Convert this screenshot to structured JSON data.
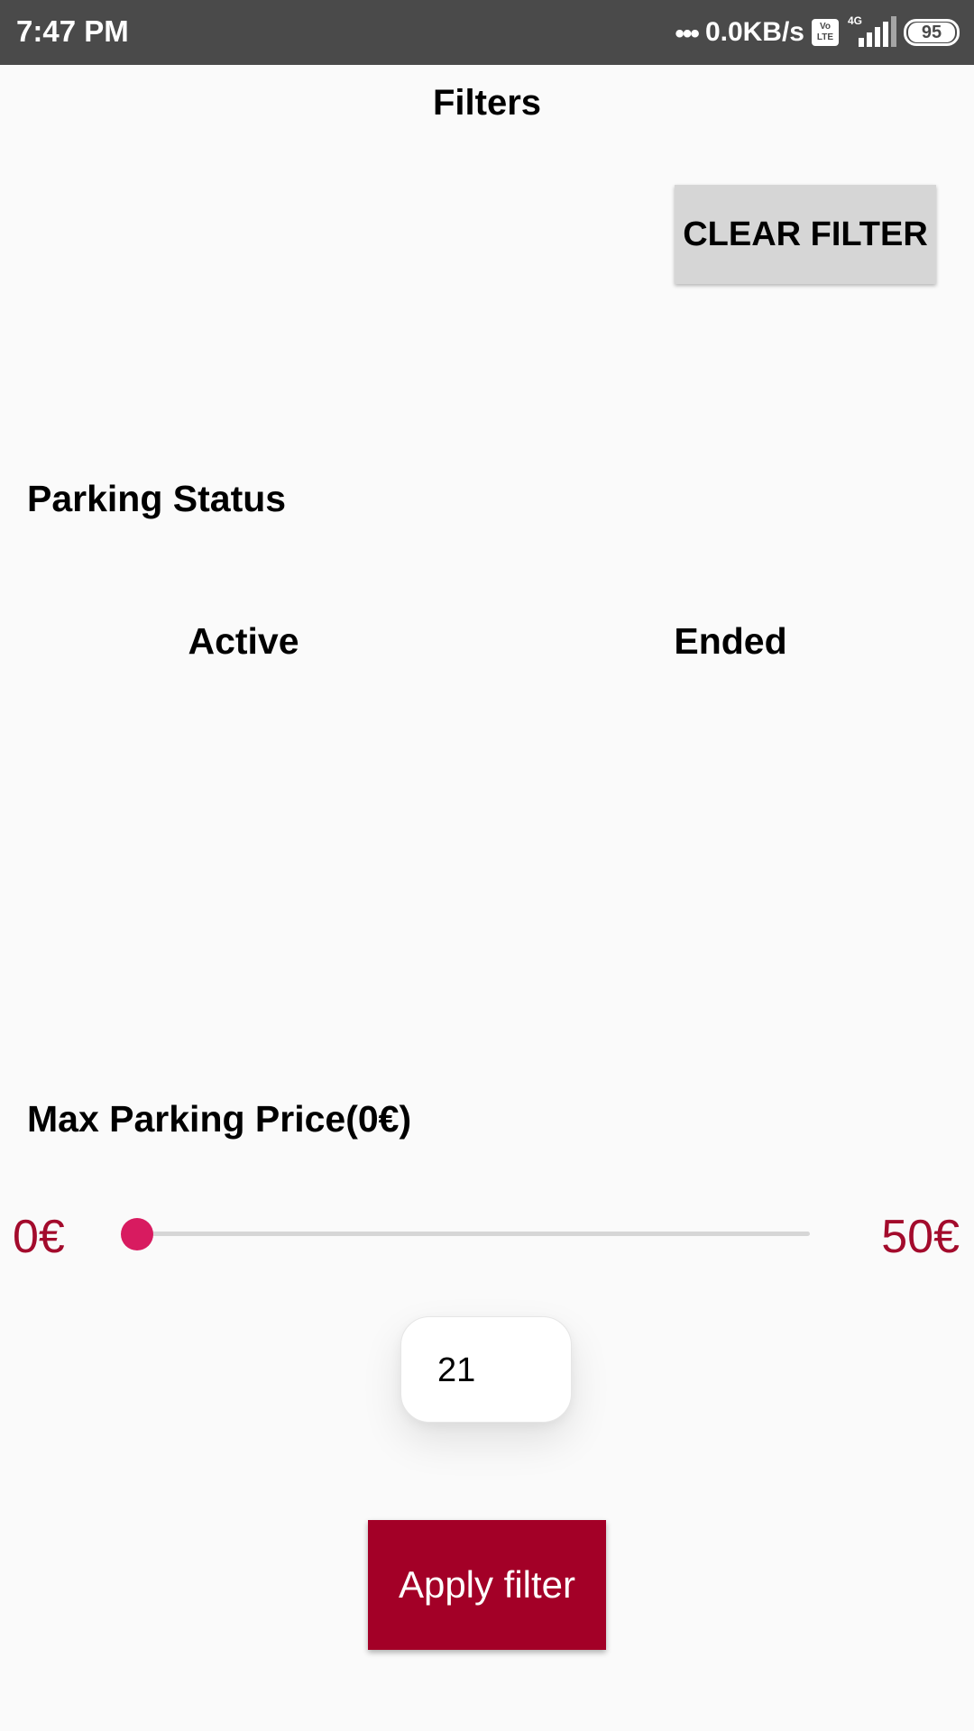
{
  "status_bar": {
    "time": "7:47 PM",
    "dots": "•••",
    "network_speed": "0.0KB/s",
    "volte_top": "Vo",
    "volte_bottom": "LTE",
    "network_type": "4G",
    "battery": "95",
    "icons": [
      "volte-icon",
      "signal-icon",
      "battery-icon"
    ]
  },
  "header": {
    "title": "Filters",
    "clear_button": "CLEAR FILTER"
  },
  "parking_status": {
    "label": "Parking Status",
    "options": [
      "Active",
      "Ended"
    ]
  },
  "price": {
    "label": "Max Parking Price(0€)",
    "min_label": "0€",
    "max_label": "50€",
    "min_value": 0,
    "max_value": 50,
    "current_value": 0,
    "tooltip_value": "21"
  },
  "apply_button": "Apply filter",
  "colors": {
    "status_bar": "#4a4a4a",
    "background": "#fafafa",
    "clear_button": "#d6d6d6",
    "accent": "#d81b60",
    "range_text": "#a30b2c",
    "apply_button": "#a30027"
  }
}
